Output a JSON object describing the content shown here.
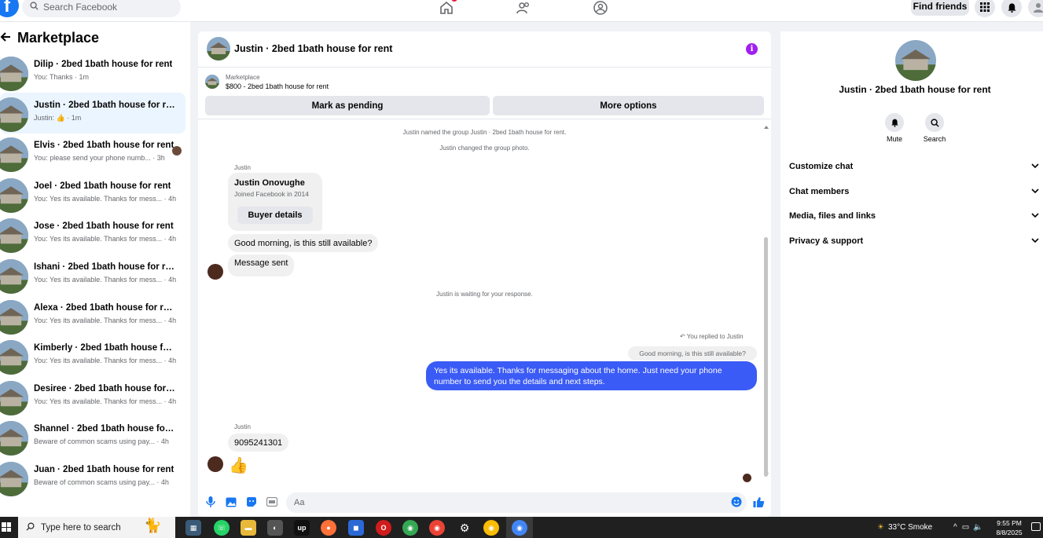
{
  "topbar": {
    "logo": "f",
    "search_placeholder": "Search Facebook",
    "find_friends": "Find friends"
  },
  "sidebar": {
    "title": "Marketplace",
    "conversations": [
      {
        "title": "Dilip · 2bed 1bath house for rent",
        "sub": "You: Thanks · 1m"
      },
      {
        "title": "Justin · 2bed 1bath house for rent",
        "sub": "Justin: 👍 · 1m"
      },
      {
        "title": "Elvis · 2bed 1bath house for rent",
        "sub": "You: please send your phone numb... · 3h"
      },
      {
        "title": "Joel · 2bed 1bath house for rent",
        "sub": "You: Yes its available. Thanks for mess... · 4h"
      },
      {
        "title": "Jose · 2bed 1bath house for rent",
        "sub": "You: Yes its available. Thanks for mess... · 4h"
      },
      {
        "title": "Ishani · 2bed 1bath house for rent",
        "sub": "You: Yes its available. Thanks for mess... · 4h"
      },
      {
        "title": "Alexa · 2bed 1bath house for rent",
        "sub": "You: Yes its available. Thanks for mess... · 4h"
      },
      {
        "title": "Kimberly · 2bed 1bath house for re...",
        "sub": "You: Yes its available. Thanks for mess... · 4h"
      },
      {
        "title": "Desiree · 2bed 1bath house for rent",
        "sub": "You: Yes its available. Thanks for mess... · 4h"
      },
      {
        "title": "Shannel · 2bed 1bath house for rent",
        "sub": "Beware of common scams using pay... · 4h"
      },
      {
        "title": "Juan · 2bed 1bath house for rent",
        "sub": "Beware of common scams using pay... · 4h"
      }
    ]
  },
  "chat": {
    "header_title": "Justin · 2bed 1bath house for rent",
    "marketplace_label": "Marketplace",
    "listing": "$800 - 2bed 1bath house for rent",
    "mark_pending": "Mark as pending",
    "more_options": "More options",
    "sys_named": "Justin named the group Justin · 2bed 1bath house for rent.",
    "sys_photo": "Justin changed the group photo.",
    "sender1": "Justin",
    "profile_name": "Justin Onovughe",
    "profile_joined": "Joined Facebook in 2014",
    "buyer_details": "Buyer details",
    "msg_available": "Good morning, is this still available?",
    "msg_sent": "Message sent",
    "sys_waiting": "Justin is waiting for your response.",
    "replied_to": "You replied to Justin",
    "quoted": "Good morning, is this still available?",
    "my_reply": "Yes its available. Thanks for messaging about the home. Just need your phone number to send you the details and next steps.",
    "sender2": "Justin",
    "phone_msg": "9095241301",
    "thumb": "👍",
    "composer_placeholder": "Aa"
  },
  "right_panel": {
    "name": "Justin · 2bed 1bath house for rent",
    "mute": "Mute",
    "search": "Search",
    "sections": [
      "Customize chat",
      "Chat members",
      "Media, files and links",
      "Privacy & support"
    ]
  },
  "taskbar": {
    "search_placeholder": "Type here to search",
    "weather": "33°C  Smoke",
    "time": "9:55 PM",
    "date": "8/8/2025"
  },
  "colors": {
    "accent": "#1877f2",
    "outgoing_bubble": "#3b5bf6",
    "info_purple": "#a020f0",
    "active_conv": "#ebf5ff"
  }
}
